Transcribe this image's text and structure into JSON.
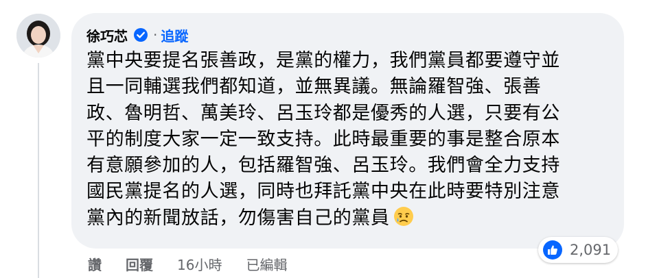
{
  "comment": {
    "author": "徐巧芯",
    "separator": "·",
    "follow_label": "追蹤",
    "lines": [
      "黨中央要提名張善政，是黨的權力，我們黨員都要遵守並",
      "且一同輔選我們都知道，並無異議。無論羅智強、張善",
      "政、魯明哲、萬美玲、呂玉玲都是優秀的人選，只要有公",
      "平的制度大家一定一致支持。此時最重要的事是整合原本",
      "有意願參加的人，包括羅智強、呂玉玲。我們會全力支持",
      "國民黨提名的人選，同時也拜託黨中央在此時要特別注意",
      "黨內的新聞放話，勿傷害自己的黨員"
    ],
    "reaction_count": "2,091"
  },
  "actions": {
    "like": "讚",
    "reply": "回覆",
    "time": "16小時",
    "edited": "已編輯"
  },
  "icons": {
    "avatar": "profile-photo",
    "verified": "verified-badge-icon",
    "emoji": "sad-but-relieved-face-emoji",
    "like": "thumbs-up-icon"
  },
  "colors": {
    "bubble": "#f0f2f5",
    "accent": "#0866ff",
    "muted": "#65676b",
    "text": "#050505"
  }
}
